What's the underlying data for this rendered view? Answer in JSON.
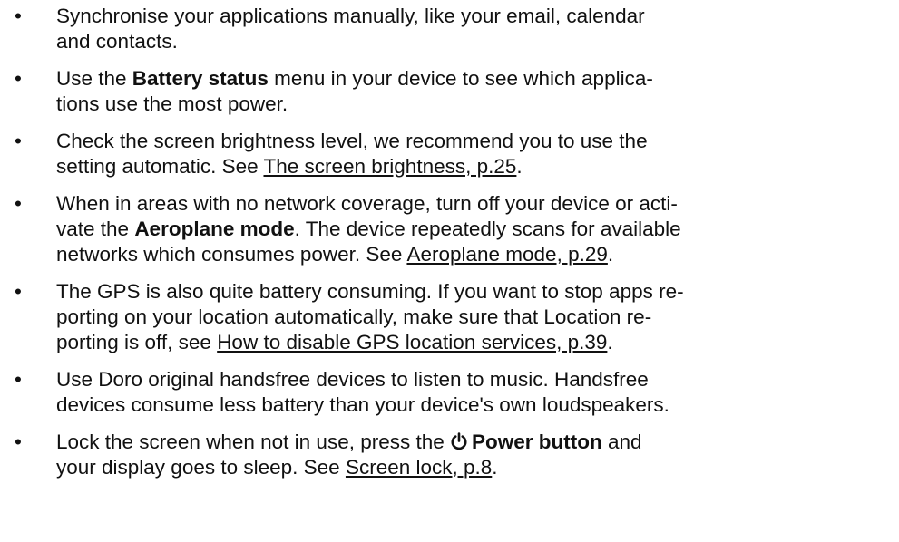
{
  "bullet_char": "•",
  "tips": [
    {
      "line1": "Synchronise your applications manually, like your email, calendar",
      "line2": "and contacts."
    },
    {
      "a": "Use the ",
      "bold": "Battery status",
      "b": " menu in your device to see which applica-",
      "line2": "tions use the most power."
    },
    {
      "line1": "Check the screen brightness level, we recommend you to use the",
      "a": "setting automatic. See ",
      "link": "The screen brightness, p.25",
      "b": "."
    },
    {
      "line1": "When in areas with no network coverage, turn off your device or acti-",
      "a": "vate the ",
      "bold": "Aeroplane mode",
      "b": ". The device repeatedly scans for available",
      "c": "networks which consumes power. See ",
      "link": "Aeroplane mode, p.29",
      "d": "."
    },
    {
      "line1": "The GPS is also quite battery consuming. If you want to stop apps re-",
      "line2": "porting on your location automatically, make sure that Location re-",
      "a": "porting is off, see ",
      "link": "How to disable GPS location services, p.39",
      "b": "."
    },
    {
      "line1": "Use Doro original handsfree devices to listen to music. Handsfree",
      "line2": "devices consume less battery than your device's own loudspeakers."
    },
    {
      "a": "Lock the screen when not in use, press the ",
      "icon": "power-icon",
      "bold": "Power button",
      "b": " and",
      "c": "your display goes to sleep. See ",
      "link": "Screen lock, p.8",
      "d": "."
    }
  ]
}
